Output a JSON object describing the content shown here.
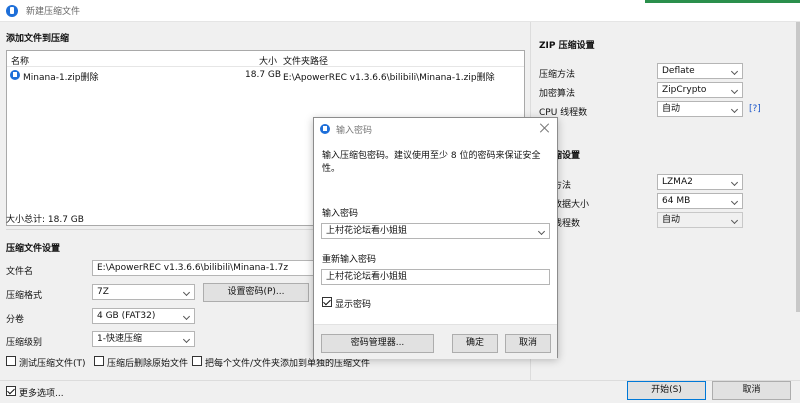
{
  "window": {
    "title": "新建压缩文件"
  },
  "files": {
    "section_title": "添加文件到压缩",
    "columns": {
      "name": "名称",
      "size": "大小",
      "path": "文件夹路径"
    },
    "rows": [
      {
        "name": "Minana-1.zip删除",
        "size": "18.7 GB",
        "path": "E:\\ApowerREC v1.3.6.6\\bilibili\\Minana-1.zip删除"
      }
    ],
    "total": "大小总计: 18.7 GB"
  },
  "archive": {
    "section_title": "压缩文件设置",
    "filename_label": "文件名",
    "filename_value": "E:\\ApowerREC v1.3.6.6\\bilibili\\Minana-1.7z",
    "format_label": "压缩格式",
    "format_value": "7Z",
    "set_password_button": "设置密码(P)...",
    "split_label": "分卷",
    "split_value": "4 GB (FAT32)",
    "level_label": "压缩级别",
    "level_value": "1-快速压缩",
    "opt_test": "测试压缩文件(T)",
    "opt_delete": "压缩后删除原始文件",
    "opt_separate": "把每个文件/文件夹添加到单独的压缩文件"
  },
  "bottom": {
    "more_options": "更多选项...",
    "start_button": "开始(S)",
    "cancel_button": "取消"
  },
  "zip_settings": {
    "section_title": "ZIP 压缩设置",
    "method_label": "压缩方法",
    "method_value": "Deflate",
    "encrypt_label": "加密算法",
    "encrypt_value": "ZipCrypto",
    "cpu_label": "CPU 线程数",
    "cpu_value": "自动",
    "help_link": "[?]"
  },
  "sevenz_settings": {
    "section_title_partial": "缩设置",
    "method_label_partial": "方法",
    "method_value": "LZMA2",
    "block_label_partial": "数据大小",
    "block_value": "64 MB",
    "cpu_label_partial": "线程数",
    "cpu_value": "自动"
  },
  "dialog": {
    "title": "输入密码",
    "hint": "输入压缩包密码。建议使用至少 8 位的密码来保证安全性。",
    "password_label": "输入密码",
    "password_value": "上村花论坛看小姐姐",
    "reenter_label": "重新输入密码",
    "reenter_value": "上村花论坛看小姐姐",
    "show_password": "显示密码",
    "manager_button": "密码管理器...",
    "ok_button": "确定",
    "cancel_button": "取消"
  }
}
